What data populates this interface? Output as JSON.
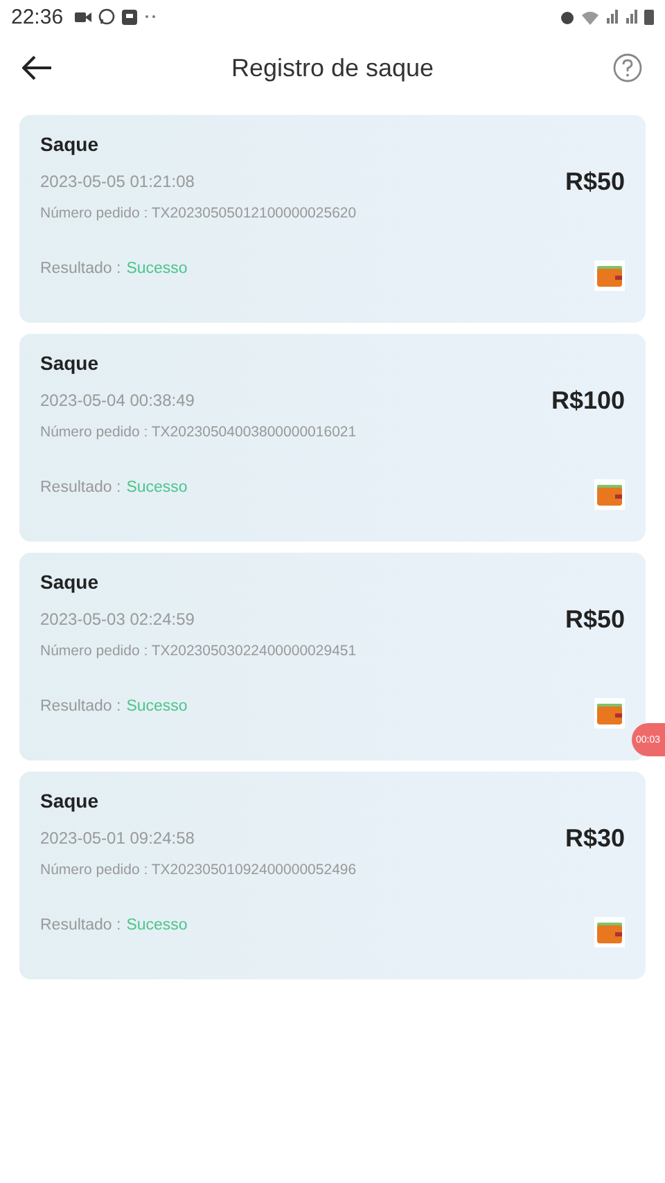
{
  "status_bar": {
    "time": "22:36"
  },
  "header": {
    "title": "Registro de saque"
  },
  "records": [
    {
      "type": "Saque",
      "datetime": "2023-05-05 01:21:08",
      "amount": "R$50",
      "order": "Número pedido : TX20230505012100000025620",
      "result_label": "Resultado :",
      "result": "Sucesso"
    },
    {
      "type": "Saque",
      "datetime": "2023-05-04 00:38:49",
      "amount": "R$100",
      "order": "Número pedido : TX20230504003800000016021",
      "result_label": "Resultado :",
      "result": "Sucesso"
    },
    {
      "type": "Saque",
      "datetime": "2023-05-03 02:24:59",
      "amount": "R$50",
      "order": "Número pedido : TX20230503022400000029451",
      "result_label": "Resultado :",
      "result": "Sucesso"
    },
    {
      "type": "Saque",
      "datetime": "2023-05-01 09:24:58",
      "amount": "R$30",
      "order": "Número pedido : TX20230501092400000052496",
      "result_label": "Resultado :",
      "result": "Sucesso"
    }
  ],
  "recording_timer": "00:03"
}
